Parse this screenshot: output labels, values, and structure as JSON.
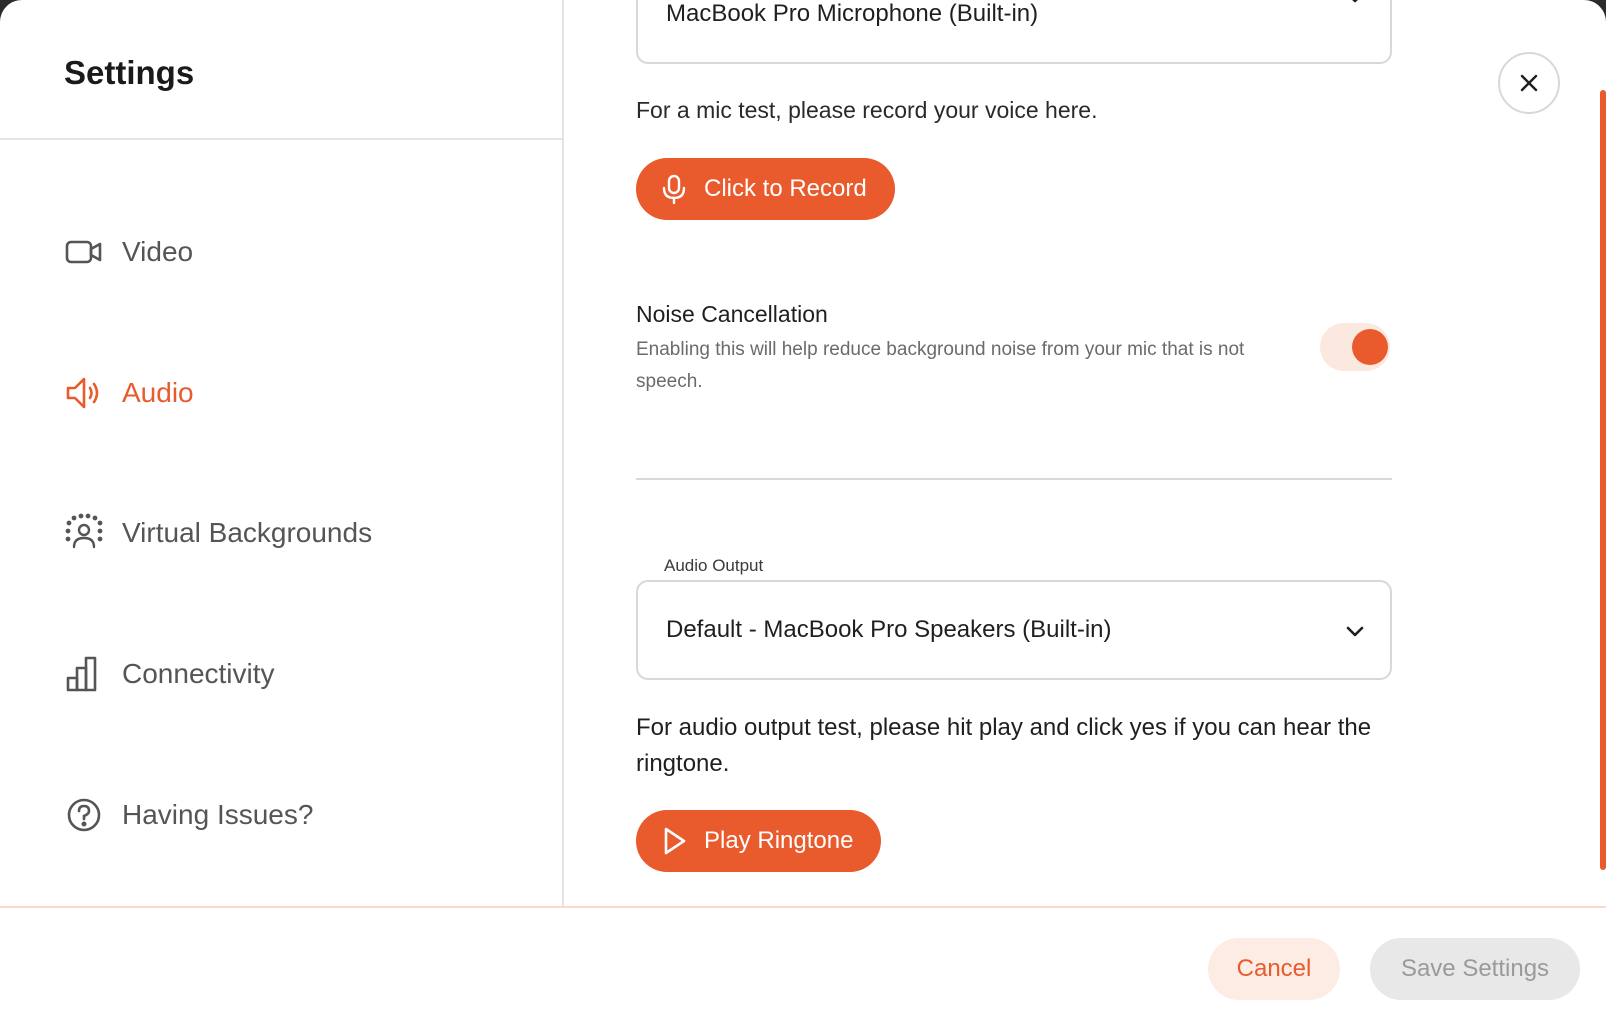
{
  "sidebar": {
    "title": "Settings",
    "items": [
      {
        "label": "Video",
        "icon": "video-camera-icon",
        "active": false
      },
      {
        "label": "Audio",
        "icon": "speaker-icon",
        "active": true
      },
      {
        "label": "Virtual Backgrounds",
        "icon": "virtual-background-icon",
        "active": false
      },
      {
        "label": "Connectivity",
        "icon": "signal-bars-icon",
        "active": false
      },
      {
        "label": "Having Issues?",
        "icon": "question-circle-icon",
        "active": false
      }
    ]
  },
  "audio": {
    "microphone_value": "MacBook Pro Microphone (Built-in)",
    "mic_test_text": "For a mic test, please record your voice here.",
    "record_button": "Click to Record",
    "noise_cancellation": {
      "title": "Noise Cancellation",
      "description": "Enabling this will help reduce background noise from your mic that is not speech.",
      "enabled": true
    },
    "output_label": "Audio Output",
    "output_value": "Default - MacBook Pro Speakers (Built-in)",
    "output_test_text": "For audio output test, please hit play and click yes if you can hear the ringtone.",
    "ringtone_button": "Play Ringtone"
  },
  "footer": {
    "cancel_label": "Cancel",
    "save_label": "Save Settings"
  },
  "colors": {
    "accent": "#e95a2c",
    "accent_light": "#fcece4",
    "disabled_bg": "#e8e8e8",
    "disabled_text": "#9a9a9a"
  }
}
